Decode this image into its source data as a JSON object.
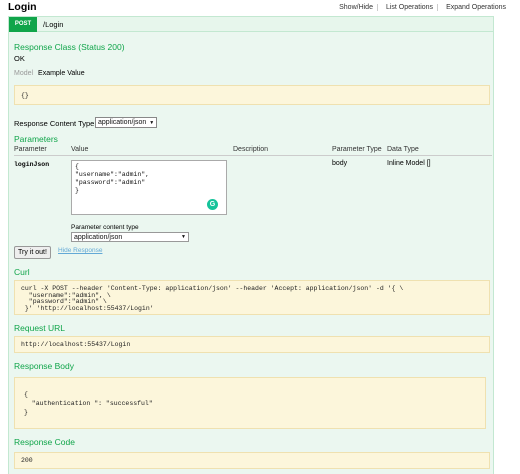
{
  "header": {
    "title": "Login",
    "links": [
      "Show/Hide",
      "List Operations",
      "Expand Operations"
    ]
  },
  "operation": {
    "method": "POST",
    "path": "/Login"
  },
  "response_class": {
    "heading": "Response Class (Status 200)",
    "status_text": "OK",
    "tab_model": "Model",
    "tab_example": "Example Value",
    "example_value": "{}"
  },
  "content_type": {
    "label": "Response Content Type",
    "selected": "application/json"
  },
  "parameters": {
    "heading": "Parameters",
    "columns": [
      "Parameter",
      "Value",
      "Description",
      "Parameter Type",
      "Data Type"
    ],
    "rows": [
      {
        "name": "loginJson",
        "value": "{\n\"username\":\"admin\",\n\"password\":\"admin\"\n}",
        "description": "",
        "param_type": "body",
        "data_type": "Inline Model []"
      }
    ],
    "content_type_label": "Parameter content type",
    "content_type_selected": "application/json"
  },
  "actions": {
    "try_label": "Try it out!",
    "hide_label": "Hide Response"
  },
  "curl": {
    "heading": "Curl",
    "command": "curl -X POST --header 'Content-Type: application/json' --header 'Accept: application/json' -d '{ \\\n  \"username\":\"admin\", \\\n  \"password\":\"admin\" \\\n }' 'http://localhost:55437/Login'"
  },
  "request_url": {
    "heading": "Request URL",
    "value": "http://localhost:55437/Login"
  },
  "response_body": {
    "heading": "Response Body",
    "value": "{\n  \"authentication \": \"successful\"\n}"
  },
  "response_code": {
    "heading": "Response Code",
    "value": "200"
  },
  "colors": {
    "accent_green": "#10a54a",
    "op_background": "#ebf7f0",
    "code_background": "#fcf6db",
    "link_blue": "#63a9d6"
  },
  "icons": [
    "grammarly-icon",
    "dropdown-caret-icon"
  ]
}
